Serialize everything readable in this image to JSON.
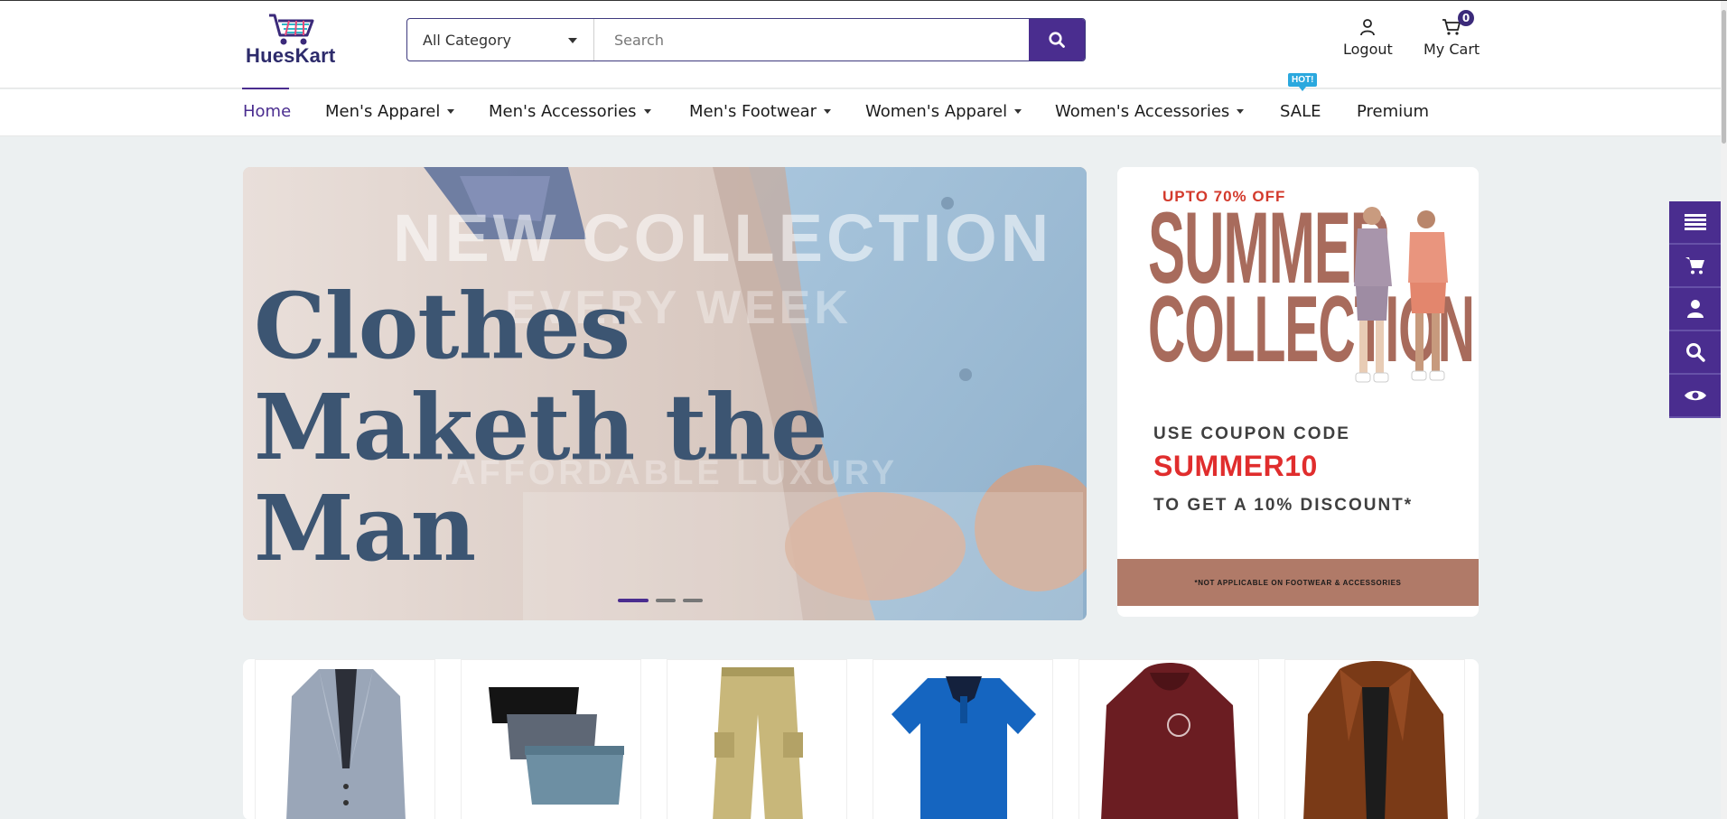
{
  "header": {
    "logo_text": "HuesKart",
    "category_select": "All Category",
    "search_placeholder": "Search",
    "logout_label": "Logout",
    "cart_label": "My Cart",
    "cart_count": "0"
  },
  "nav": {
    "items": [
      {
        "label": "Home",
        "active": true
      },
      {
        "label": "Men's Apparel",
        "dropdown": true
      },
      {
        "label": "Men's Accessories",
        "dropdown": true
      },
      {
        "label": "Men's Footwear",
        "dropdown": true
      },
      {
        "label": "Women's Apparel",
        "dropdown": true
      },
      {
        "label": "Women's Accessories",
        "dropdown": true
      },
      {
        "label": "SALE",
        "badge": "HOT!"
      },
      {
        "label": "Premium"
      }
    ]
  },
  "hero": {
    "headline_lines": [
      "Clothes",
      "Maketh the",
      "Man"
    ],
    "background_text_top": "NEW COLLECTION",
    "background_text_mid": "EVERY WEEK",
    "background_text_low": "AFFORDABLE LUXURY",
    "slide_count": 3,
    "active_slide": 1
  },
  "promo": {
    "discount_line": "UPTO 70% OFF",
    "title_line1": "SUMMER",
    "title_line2": "COLLECTION",
    "coupon_intro": "USE COUPON  CODE",
    "coupon_code": "SUMMER10",
    "coupon_outro": "TO GET A 10% DISCOUNT*",
    "footnote": "*NOT APPLICABLE ON FOOTWEAR & ACCESSORIES"
  },
  "side_toolbar": [
    "menu-icon",
    "cart-icon",
    "user-icon",
    "search-icon",
    "eye-icon"
  ],
  "products": [
    {
      "name": "blazer",
      "color": "#9aa6b8"
    },
    {
      "name": "briefs",
      "color": "#6b7a8c"
    },
    {
      "name": "cargo-pants",
      "color": "#c8b77a"
    },
    {
      "name": "polo-shirt",
      "color": "#1565c0"
    },
    {
      "name": "hoodie",
      "color": "#6b1d22"
    },
    {
      "name": "leather-jacket",
      "color": "#7a3a17"
    }
  ],
  "colors": {
    "brand": "#4a2d8f",
    "hot_badge": "#2ba8de",
    "promo_accent": "#a86b5c",
    "coupon_red": "#e02d2d"
  }
}
